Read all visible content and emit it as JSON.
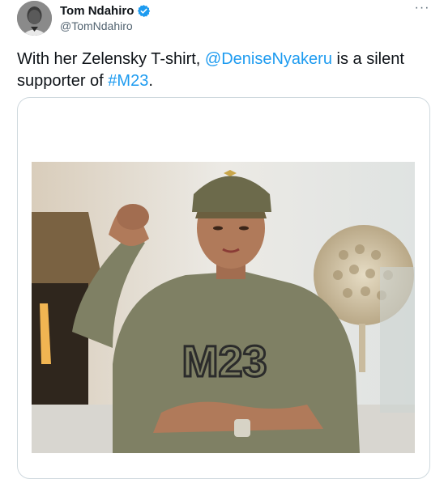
{
  "tweet": {
    "author": {
      "display_name": "Tom Ndahiro",
      "handle": "@TomNdahiro",
      "verified": true,
      "avatar_icon": "avatar-photo"
    },
    "more_label": "···",
    "text": {
      "part1": "With her Zelensky T-shirt, ",
      "mention": "@DeniseNyakeru",
      "part2": " is a silent supporter of ",
      "hashtag": "#M23",
      "part3": "."
    },
    "media": {
      "shirt_text": "M23"
    }
  },
  "colors": {
    "link": "#1d9bf0",
    "verified": "#1d9bf0",
    "text": "#0f1419",
    "secondary": "#536471",
    "border": "#cfd9de",
    "shirt": "#7f8064"
  }
}
